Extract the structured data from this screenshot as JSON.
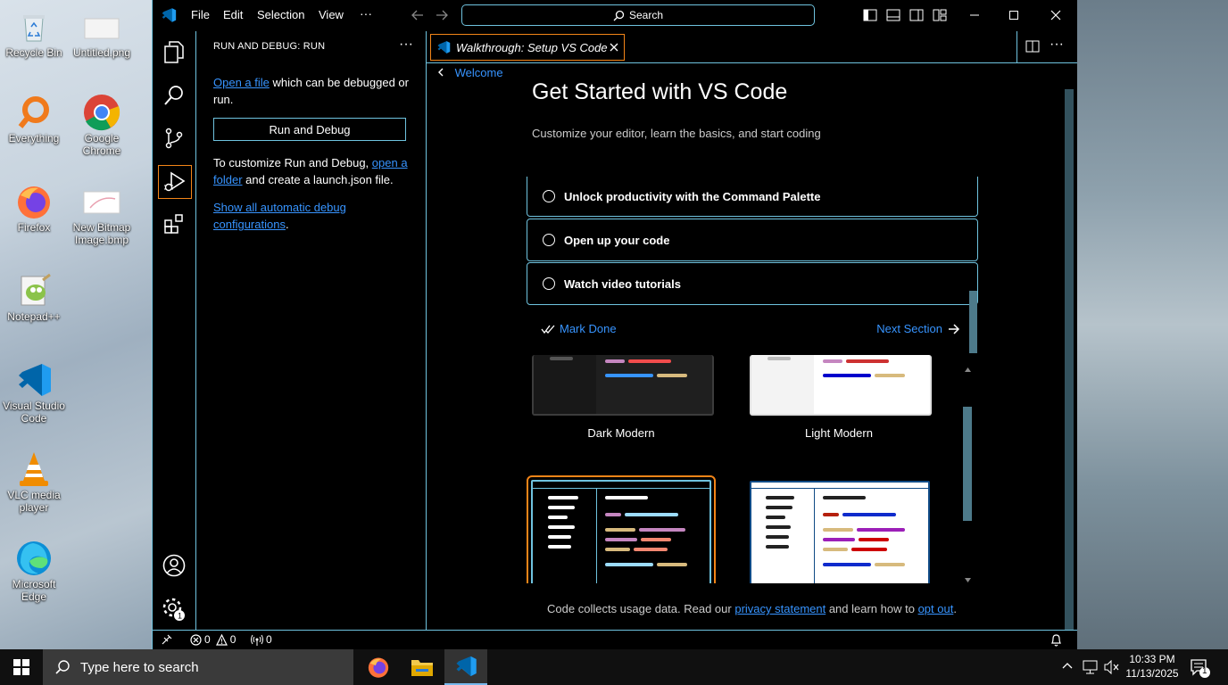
{
  "desktop": {
    "icons": [
      {
        "label": "Recycle Bin"
      },
      {
        "label": "Untitled.png"
      },
      {
        "label": "Everything"
      },
      {
        "label": "Google Chrome"
      },
      {
        "label": "Firefox"
      },
      {
        "label": "New Bitmap Image.bmp"
      },
      {
        "label": "Notepad++"
      },
      {
        "label": "Visual Studio Code"
      },
      {
        "label": "VLC media player"
      },
      {
        "label": "Microsoft Edge"
      }
    ]
  },
  "titlebar": {
    "menu": [
      "File",
      "Edit",
      "Selection",
      "View",
      "···"
    ],
    "search_label": "Search"
  },
  "sidebar": {
    "title": "RUN AND DEBUG: RUN",
    "more": "···",
    "open_file_link": "Open a file",
    "open_file_rest": " which can be debugged or run.",
    "run_button": "Run and Debug",
    "customize_prefix": "To customize Run and Debug, ",
    "open_folder_link": "open a folder",
    "customize_suffix": " and create a launch.json file.",
    "show_configs_link": "Show all automatic debug configurations",
    "show_configs_suffix": "."
  },
  "editor": {
    "tab_label": "Walkthrough: Setup VS Code",
    "breadcrumb": "Welcome",
    "title": "Get Started with VS Code",
    "subtitle": "Customize your editor, learn the basics, and start coding",
    "steps": [
      {
        "label": "Unlock productivity with the Command Palette"
      },
      {
        "label": "Open up your code"
      },
      {
        "label": "Watch video tutorials"
      }
    ],
    "mark_done": "Mark Done",
    "next_section": "Next Section",
    "themes": [
      {
        "label": "Dark Modern"
      },
      {
        "label": "Light Modern"
      }
    ],
    "footer_prefix": "Code collects usage data. Read our ",
    "privacy_link": "privacy statement",
    "footer_middle": " and learn how to ",
    "opt_out_link": "opt out",
    "footer_suffix": "."
  },
  "statusbar": {
    "errors": "0",
    "warnings": "0",
    "ports": "0"
  },
  "taskbar": {
    "search_placeholder": "Type here to search",
    "time": "10:33 PM",
    "date": "11/13/2025",
    "notifications": "1"
  },
  "colors": {
    "accent_border": "#6fc3df",
    "active_border": "#f38518",
    "link": "#3794ff"
  }
}
